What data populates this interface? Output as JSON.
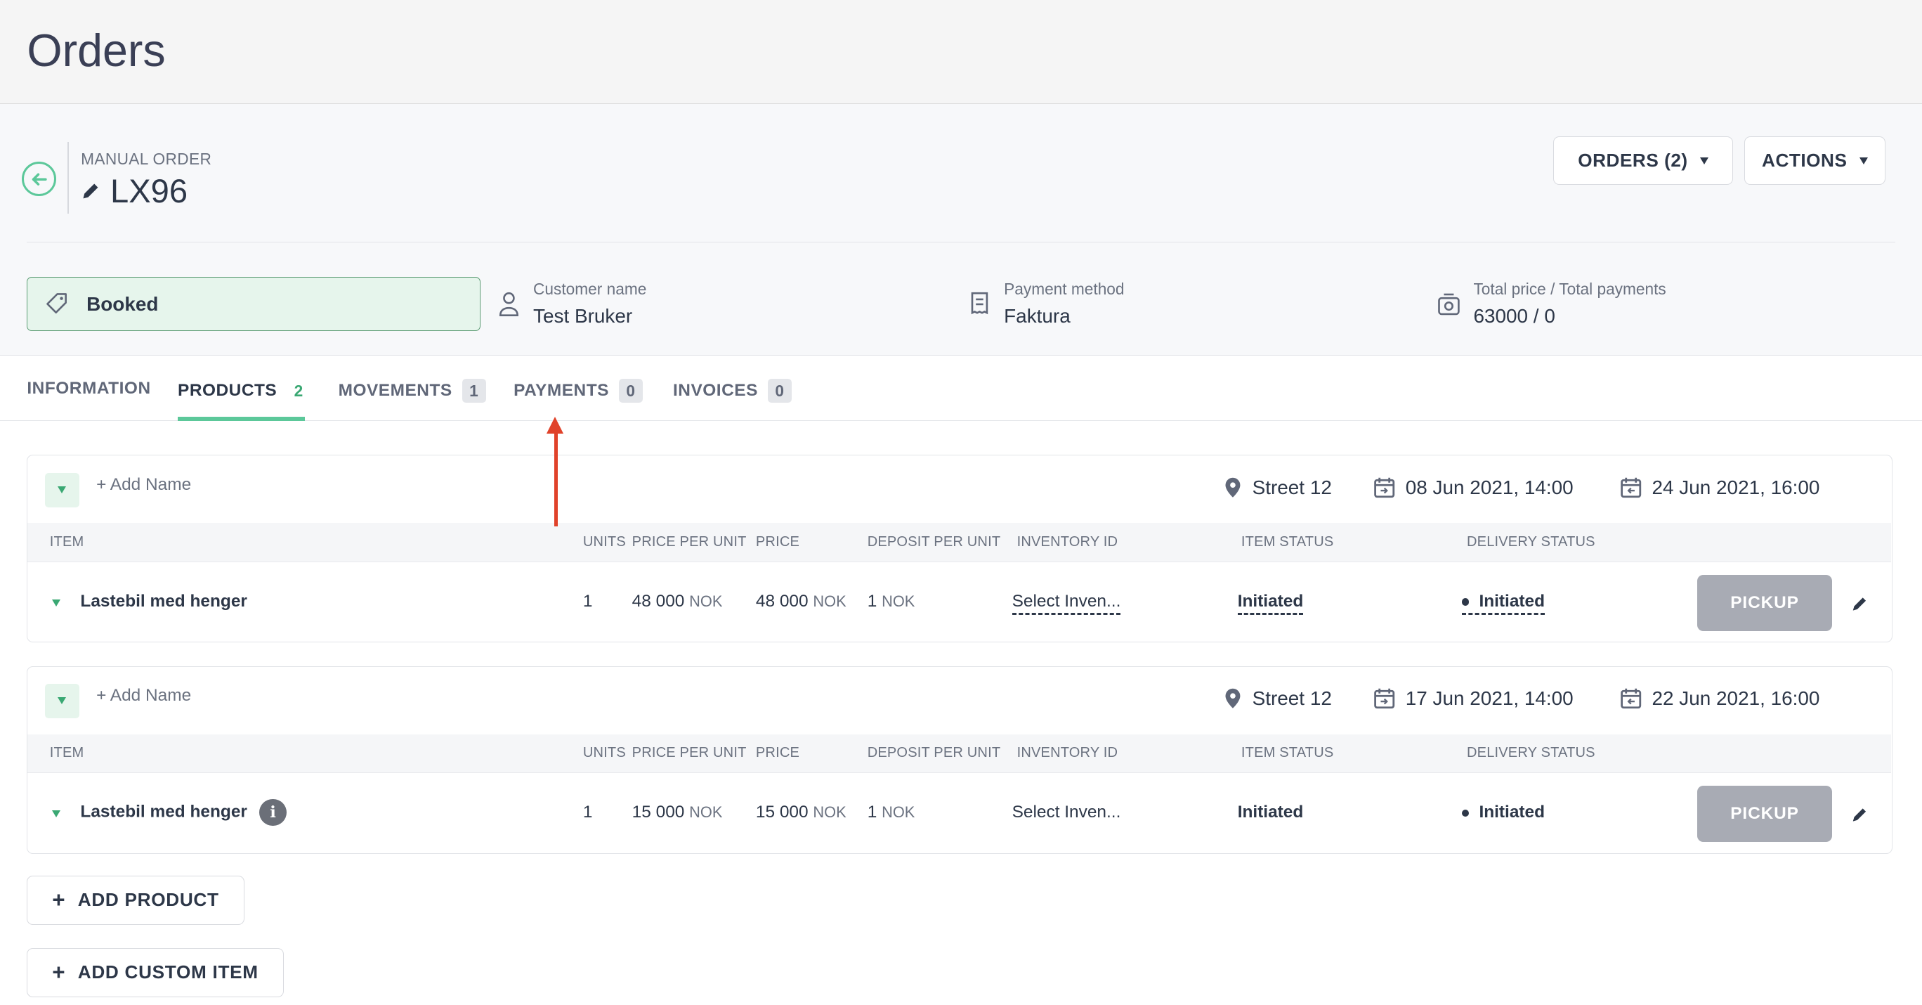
{
  "page": {
    "title": "Orders"
  },
  "header": {
    "manual_label": "MANUAL ORDER",
    "order_id": "LX96",
    "orders_button": "ORDERS (2)",
    "actions_button": "ACTIONS"
  },
  "summary": {
    "status": "Booked",
    "customer_key": "Customer name",
    "customer_value": "Test Bruker",
    "payment_key": "Payment method",
    "payment_value": "Faktura",
    "total_key": "Total price / Total payments",
    "total_value": "63000 / 0"
  },
  "tabs": [
    {
      "label": "INFORMATION",
      "count": ""
    },
    {
      "label": "PRODUCTS",
      "count": "2"
    },
    {
      "label": "MOVEMENTS",
      "count": "1"
    },
    {
      "label": "PAYMENTS",
      "count": "0"
    },
    {
      "label": "INVOICES",
      "count": "0"
    }
  ],
  "columns": {
    "item": "ITEM",
    "units": "UNITS",
    "ppu": "PRICE PER UNIT",
    "price": "PRICE",
    "deposit": "DEPOSIT PER UNIT",
    "inventory": "INVENTORY ID",
    "item_status": "ITEM STATUS",
    "delivery": "DELIVERY STATUS"
  },
  "currency": "NOK",
  "add_name": "+ Add Name",
  "pickup_label": "PICKUP",
  "products": [
    {
      "location": "Street 12",
      "start": "08 Jun 2021, 14:00",
      "end": "24 Jun 2021, 16:00",
      "item": "Lastebil med henger",
      "units": "1",
      "ppu": "48 000",
      "price": "48 000",
      "deposit": "1",
      "inventory": "Select Inven...",
      "item_status": "Initiated",
      "delivery": "Initiated"
    },
    {
      "location": "Street 12",
      "start": "17 Jun 2021, 14:00",
      "end": "22 Jun 2021, 16:00",
      "item": "Lastebil med henger",
      "units": "1",
      "ppu": "15 000",
      "price": "15 000",
      "deposit": "1",
      "inventory": "Select Inven...",
      "item_status": "Initiated",
      "delivery": "Initiated"
    }
  ],
  "buttons": {
    "add_product": "ADD PRODUCT",
    "add_custom": "ADD CUSTOM ITEM"
  },
  "colors": {
    "accent": "#5cc89a",
    "annotation_arrow": "#e0422a",
    "pickup_disabled": "#a8abb4"
  }
}
